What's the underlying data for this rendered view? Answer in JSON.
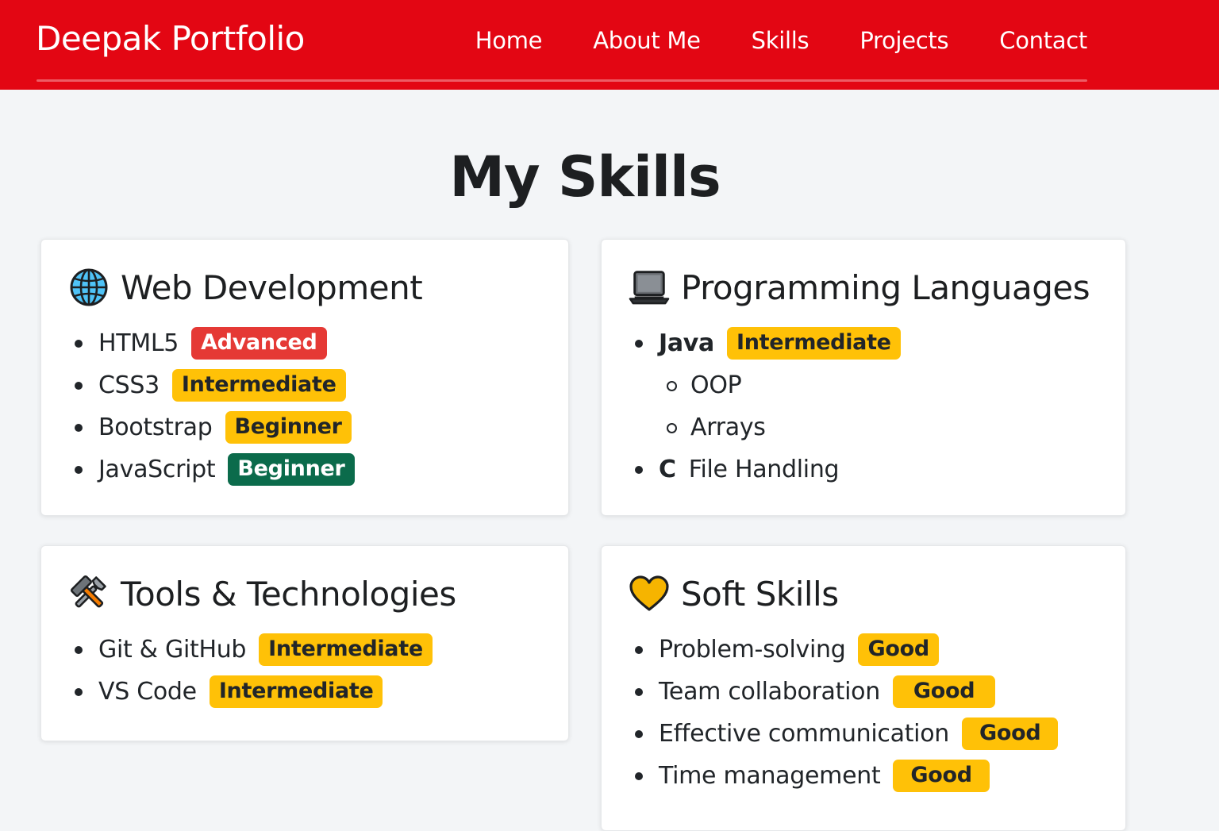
{
  "nav": {
    "brand": "Deepak Portfolio",
    "links": [
      "Home",
      "About Me",
      "Skills",
      "Projects",
      "Contact"
    ],
    "background": "#e30613"
  },
  "page": {
    "title": "My Skills"
  },
  "badge_colors": {
    "Advanced": {
      "bg": "#e53935",
      "fg": "#ffffff"
    },
    "Intermediate": {
      "bg": "#ffc107",
      "fg": "#212529"
    },
    "Beginner": {
      "bg": "#ffc107",
      "fg": "#212529"
    },
    "Beginner-alt": {
      "bg": "#0b6b4b",
      "fg": "#ffffff"
    },
    "Good": {
      "bg": "#ffc107",
      "fg": "#212529"
    }
  },
  "cards": {
    "web": {
      "icon": "globe-icon",
      "title": "Web Development",
      "items": [
        {
          "label": "HTML5",
          "level": "Advanced"
        },
        {
          "label": "CSS3",
          "level": "Intermediate"
        },
        {
          "label": "Bootstrap",
          "level": "Beginner"
        },
        {
          "label": "JavaScript",
          "level": "Beginner"
        }
      ]
    },
    "prog": {
      "icon": "laptop-icon",
      "title": "Programming Languages",
      "items": [
        {
          "label": "Java",
          "level": "Intermediate"
        },
        {
          "label": "OOP"
        },
        {
          "label": "Arrays"
        },
        {
          "label": "C",
          "detail": "File Handling"
        }
      ]
    },
    "tools": {
      "icon": "hammer-wrench-icon",
      "title": "Tools & Technologies",
      "items": [
        {
          "label": "Git & GitHub",
          "level": "Intermediate"
        },
        {
          "label": "VS Code",
          "level": "Intermediate"
        }
      ]
    },
    "soft": {
      "icon": "heart-icon",
      "title": "Soft Skills",
      "items": [
        {
          "label": "Problem-solving",
          "level": "Good"
        },
        {
          "label": "Team collaboration",
          "level": "Good"
        },
        {
          "label": "Effective communication",
          "level": "Good"
        },
        {
          "label": "Time management",
          "level": "Good"
        }
      ]
    }
  }
}
